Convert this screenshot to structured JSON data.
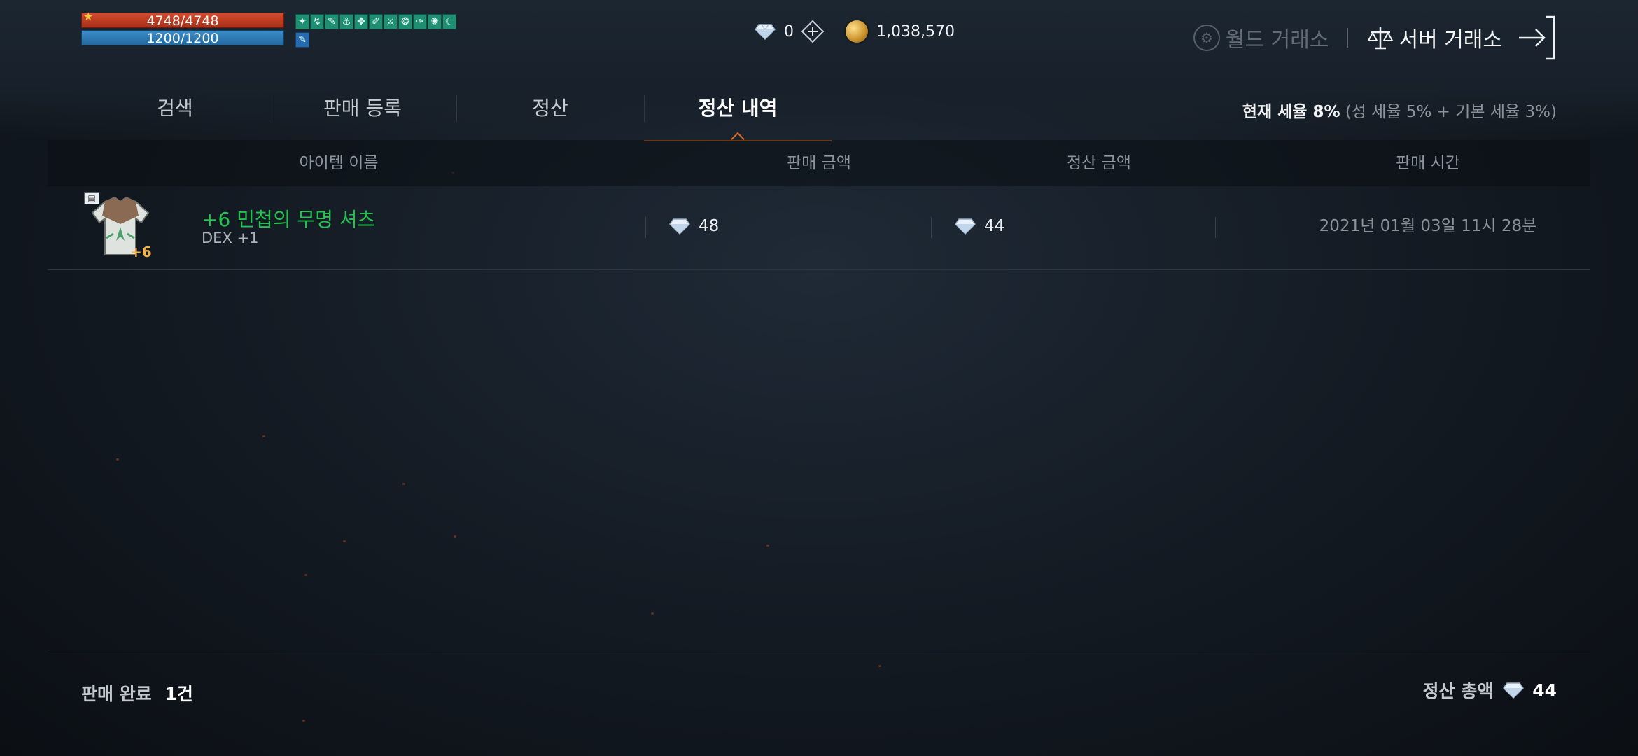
{
  "status": {
    "hp_text": "4748/4748",
    "mp_text": "1200/1200",
    "hp_fraction": 1.0,
    "mp_fraction": 1.0,
    "buff_icons": [
      "buff-icon",
      "buff-icon",
      "buff-icon",
      "buff-icon",
      "buff-icon",
      "buff-icon",
      "buff-icon",
      "buff-icon",
      "buff-icon",
      "buff-icon",
      "buff-icon"
    ],
    "colors": {
      "hp": "#c23d22",
      "mp": "#2f7cbc",
      "buff": "#1f8f74"
    }
  },
  "currency": {
    "diamond": "0",
    "adena": "1,038,570",
    "diamond_icon": "diamond-icon",
    "adena_icon": "gold-coin-icon",
    "add_icon": "plus-icon"
  },
  "exchange": {
    "world_label": "월드 거래소",
    "separator": "|",
    "server_label": "서버 거래소",
    "exit_icon": "exit-arrow-icon"
  },
  "tabs": [
    {
      "label": "검색",
      "active": false
    },
    {
      "label": "판매 등록",
      "active": false
    },
    {
      "label": "정산",
      "active": false
    },
    {
      "label": "정산 내역",
      "active": true
    }
  ],
  "tax": {
    "current_label": "현재 세율 8%",
    "detail": "(성 세율 5% + 기본 세율 3%)"
  },
  "table": {
    "headers": [
      "아이템 이름",
      "판매 금액",
      "정산 금액",
      "판매 시간"
    ],
    "rows": [
      {
        "name": "+6 민첩의 무명 셔츠",
        "sub": "DEX +1",
        "enchant": "+6",
        "sale_price": "48",
        "settle_price": "44",
        "time": "2021년 01월 03일 11시 28분",
        "name_color": "#22c44e"
      }
    ]
  },
  "footer": {
    "done_label": "판매 완료",
    "done_count": "1건",
    "total_label": "정산 총액",
    "total_amount": "44"
  },
  "theme": {
    "accent": "#d96a22",
    "background": "#151c25"
  }
}
